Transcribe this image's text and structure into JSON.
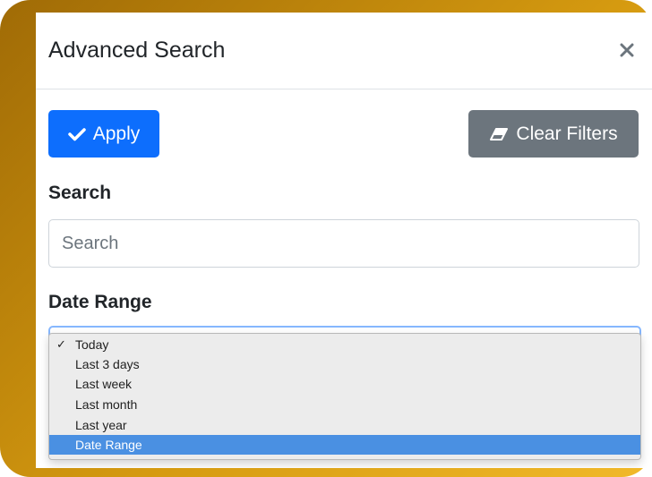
{
  "modal": {
    "title": "Advanced Search",
    "close_symbol": "×"
  },
  "toolbar": {
    "apply_icon": "check-icon",
    "apply_label": "Apply",
    "clear_icon": "eraser-icon",
    "clear_label": "Clear Filters"
  },
  "search": {
    "label": "Search",
    "placeholder": "Search",
    "value": ""
  },
  "date_range": {
    "label": "Date Range",
    "check_symbol": "✓",
    "checked_option": "Today",
    "highlighted_option": "Date Range",
    "options": [
      "Today",
      "Last 3 days",
      "Last week",
      "Last month",
      "Last year",
      "Date Range"
    ]
  },
  "colors": {
    "frame_gold": "#d59a10",
    "primary": "#0d6efd",
    "secondary": "#6c757d",
    "highlight": "#4a90e2"
  }
}
